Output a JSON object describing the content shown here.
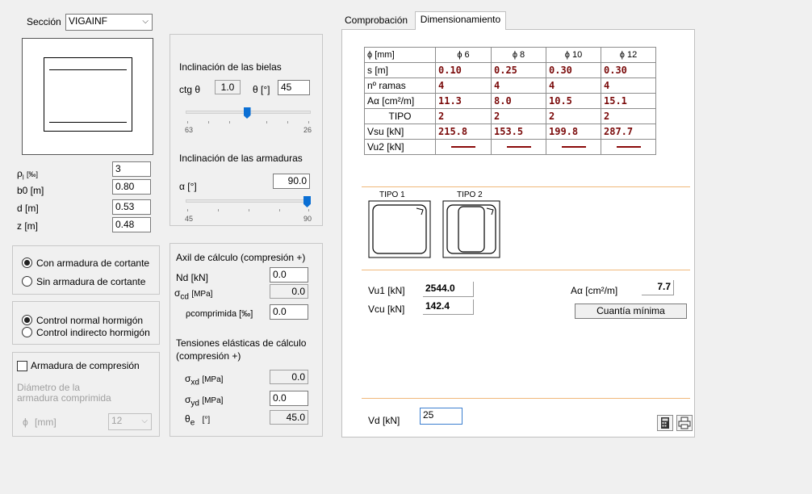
{
  "section": {
    "label": "Sección",
    "value": "VIGAINF"
  },
  "params": [
    {
      "symbol": "ρ",
      "sub": "l",
      "unit": "[‰]",
      "value": "3"
    },
    {
      "label": "b0 [m]",
      "value": "0.80"
    },
    {
      "label": "d [m]",
      "value": "0.53"
    },
    {
      "label": "z [m]",
      "value": "0.48"
    }
  ],
  "shear_options": [
    "Con armadura de cortante",
    "Sin armadura de cortante"
  ],
  "control_options": [
    "Control normal hormigón",
    "Control indirecto hormigón"
  ],
  "compression": {
    "checkbox_label": "Armadura de compresión",
    "diam_label_1": "Diámetro de la",
    "diam_label_2": "armadura comprimida",
    "phi_label": "ϕ",
    "mm_label": "[mm]",
    "diam_value": "12"
  },
  "bielas": {
    "title": "Inclinación de las bielas",
    "ctg_label": "ctg θ",
    "ctg_value": "1.0",
    "theta_label": "θ [°]",
    "theta_value": "45",
    "slider_min": "63",
    "slider_max": "26",
    "slider_fraction": 0.49
  },
  "armaduras": {
    "title": "Inclinación de las armaduras",
    "alpha_label": "α [°]",
    "alpha_value": "90.0",
    "slider_min": "45",
    "slider_max": "90",
    "slider_fraction": 1.0
  },
  "axil": {
    "title": "Axil de cálculo (compresión +)",
    "nd_label": "Nd [kN]",
    "nd_value": "0.0",
    "scd_sym": "σ",
    "scd_sub": "cd",
    "scd_unit": "[MPa]",
    "scd_value": "0.0",
    "rho_label": "ρcomprimida [‰]",
    "rho_value": "0.0",
    "tens_title_1": "Tensiones elásticas de cálculo",
    "tens_title_2": "(compresión +)",
    "sxd_sym": "σ",
    "sxd_sub": "xd",
    "sxd_unit": "[MPa]",
    "sxd_value": "0.0",
    "syd_sym": "σ",
    "syd_sub": "yd",
    "syd_unit": "[MPa]",
    "syd_value": "0.0",
    "te_sym": "θ",
    "te_sub": "e",
    "te_unit": "[°]",
    "te_value": "45.0"
  },
  "tabs": [
    "Comprobación",
    "Dimensionamiento"
  ],
  "table": {
    "header": [
      "ϕ   [mm]",
      "ϕ 6",
      "ϕ 8",
      "ϕ 10",
      "ϕ 12"
    ],
    "rows": [
      {
        "label": "s [m]",
        "values": [
          "0.10",
          "0.25",
          "0.30",
          "0.30"
        ]
      },
      {
        "label": "nº ramas",
        "values": [
          "4",
          "4",
          "4",
          "4"
        ]
      },
      {
        "label": "Aα [cm²/m]",
        "values": [
          "11.3",
          "8.0",
          "10.5",
          "15.1"
        ]
      },
      {
        "label": "TIPO",
        "values": [
          "2",
          "2",
          "2",
          "2"
        ]
      },
      {
        "label": "Vsu [kN]",
        "values": [
          "215.8",
          "153.5",
          "199.8",
          "287.7"
        ]
      },
      {
        "label": "Vu2 [kN]",
        "values": [
          "—",
          "—",
          "—",
          "—"
        ]
      }
    ]
  },
  "tipos": [
    "TIPO 1",
    "TIPO 2"
  ],
  "results": {
    "vu1_label": "Vu1 [kN]",
    "vu1_value": "2544.0",
    "vcu_label": "Vcu [kN]",
    "vcu_value": "142.4",
    "aa_label": "Aα  [cm²/m]",
    "aa_value": "7.7",
    "cuantia": "Cuantía mínima"
  },
  "vd": {
    "label": "Vd  [kN]",
    "value": "25"
  }
}
